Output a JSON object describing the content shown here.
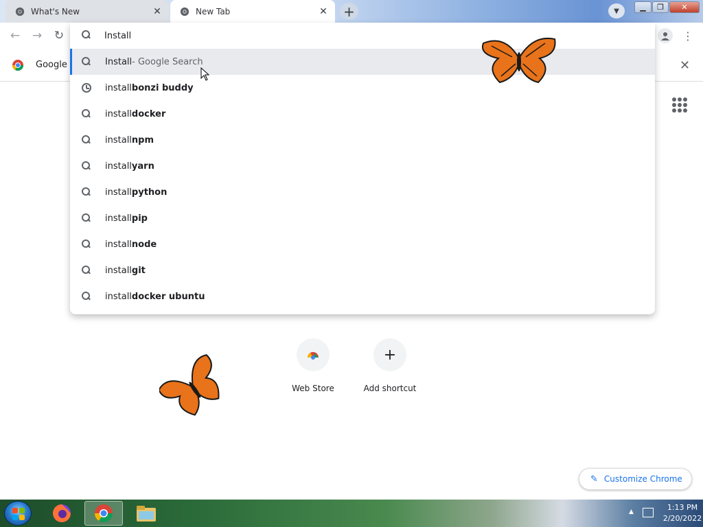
{
  "tabs": [
    {
      "title": "What's New",
      "active": false
    },
    {
      "title": "New Tab",
      "active": true
    }
  ],
  "toolbar": {
    "omnibox_text": "Install"
  },
  "infobar": {
    "label": "Google C"
  },
  "omnibox_suggestions": [
    {
      "type": "search",
      "base": "Install",
      "suffix": "",
      "description": " - Google Search",
      "selected": true
    },
    {
      "type": "history",
      "base": "install ",
      "suffix": "bonzi buddy",
      "description": "",
      "selected": false
    },
    {
      "type": "search",
      "base": "install ",
      "suffix": "docker",
      "description": "",
      "selected": false
    },
    {
      "type": "search",
      "base": "install ",
      "suffix": "npm",
      "description": "",
      "selected": false
    },
    {
      "type": "search",
      "base": "install ",
      "suffix": "yarn",
      "description": "",
      "selected": false
    },
    {
      "type": "search",
      "base": "install ",
      "suffix": "python",
      "description": "",
      "selected": false
    },
    {
      "type": "search",
      "base": "install ",
      "suffix": "pip",
      "description": "",
      "selected": false
    },
    {
      "type": "search",
      "base": "install ",
      "suffix": "node",
      "description": "",
      "selected": false
    },
    {
      "type": "search",
      "base": "install ",
      "suffix": "git",
      "description": "",
      "selected": false
    },
    {
      "type": "search",
      "base": "install ",
      "suffix": "docker ubuntu",
      "description": "",
      "selected": false
    }
  ],
  "shortcuts": [
    {
      "name": "Web Store",
      "icon": "web-store-icon"
    },
    {
      "name": "Add shortcut",
      "icon": "plus-icon"
    }
  ],
  "customize_label": "Customize Chrome",
  "taskbar": {
    "time": "1:13 PM",
    "date": "2/20/2022",
    "apps": [
      "firefox-icon",
      "chrome-icon",
      "file-explorer-icon"
    ]
  },
  "colors": {
    "accent": "#1a73e8",
    "butterfly_orange": "#e8731a"
  }
}
